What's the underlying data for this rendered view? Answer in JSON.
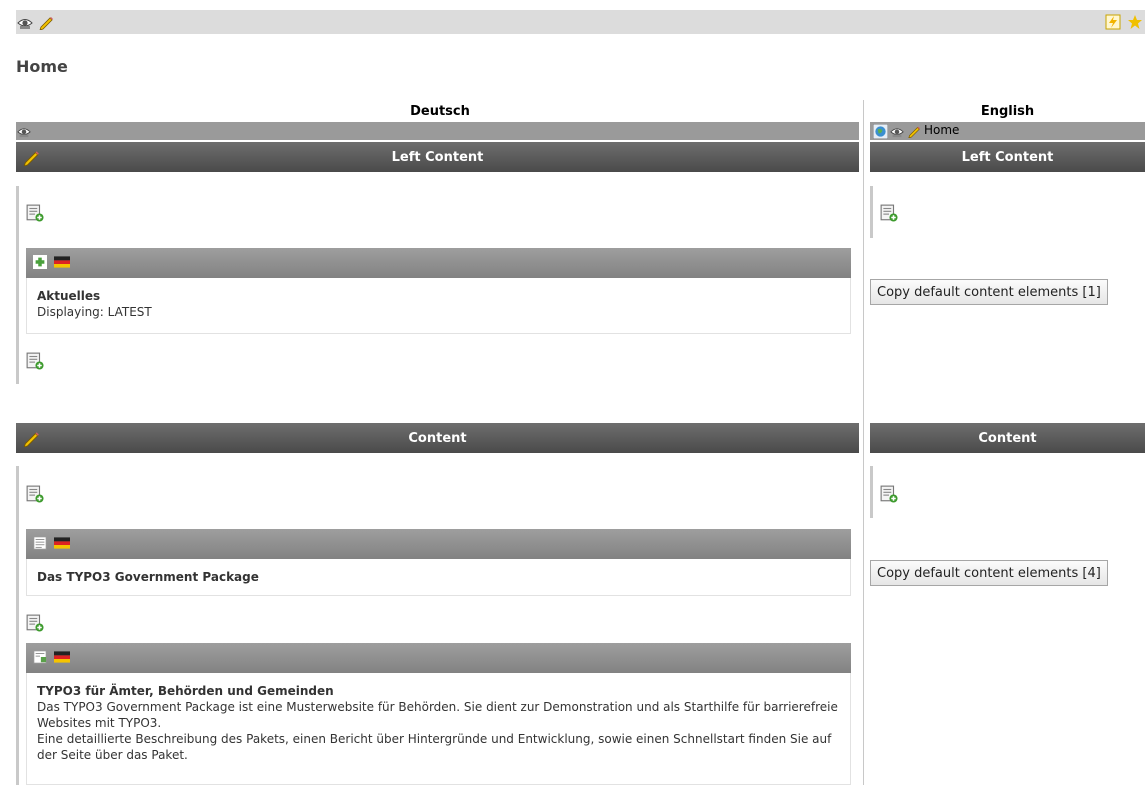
{
  "toolbar": {
    "view_icon": "view-page-icon",
    "edit_icon": "edit-page-properties-icon",
    "clear_cache_icon": "clear-cache-icon",
    "bookmark_icon": "bookmark-icon"
  },
  "page": {
    "title": "Home"
  },
  "languages": {
    "default": {
      "label": "Deutsch"
    },
    "translation": {
      "label": "English",
      "page_title": "Home"
    }
  },
  "columns": [
    {
      "id": "left",
      "label": "Left Content",
      "translation_label": "Left Content",
      "copy_button": "Copy default content elements [1]",
      "elements": [
        {
          "title": "Aktuelles",
          "lines": [
            "Displaying: LATEST"
          ],
          "type_icon": "plugin-icon",
          "flag": "german-flag-icon"
        }
      ]
    },
    {
      "id": "main",
      "label": "Content",
      "translation_label": "Content",
      "copy_button": "Copy default content elements [4]",
      "elements": [
        {
          "title": "Das TYPO3 Government Package",
          "lines": [],
          "type_icon": "text-element-icon",
          "flag": "german-flag-icon"
        },
        {
          "title": "TYPO3 für Ämter, Behörden und Gemeinden",
          "lines": [
            "Das TYPO3 Government Package ist eine Musterwebsite für Behörden. Sie dient zur Demonstration und als Starthilfe für barrierefreie Websites mit TYPO3.",
            "Eine detaillierte Beschreibung des Pakets, einen Bericht über Hintergründe und Entwicklung, sowie einen Schnellstart finden Sie auf der Seite über das Paket."
          ],
          "type_icon": "text-with-image-icon",
          "flag": "german-flag-icon"
        }
      ]
    }
  ]
}
